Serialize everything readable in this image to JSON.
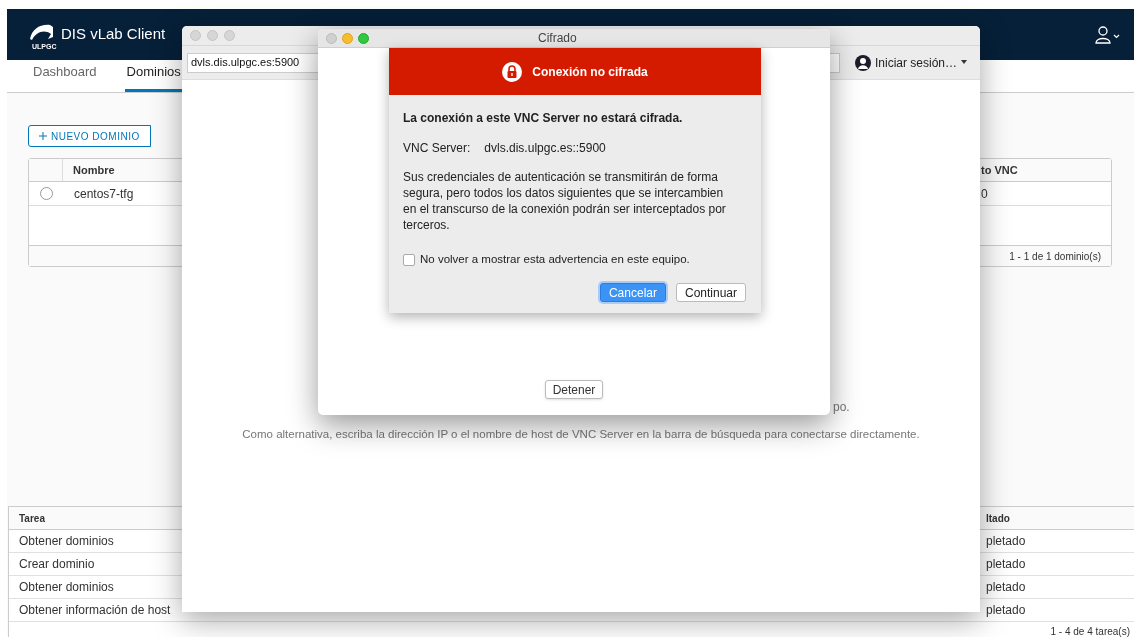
{
  "app": {
    "title": "DIS vLab Client",
    "logo_text": "ULPGC"
  },
  "tabs": [
    {
      "label": "Dashboard",
      "selected": false
    },
    {
      "label": "Dominios",
      "selected": true
    }
  ],
  "toolbar": {
    "new_button": "NUEVO DOMINIO"
  },
  "domains": {
    "columns": [
      "Nombre",
      "to VNC"
    ],
    "rows": [
      {
        "selected": false,
        "cells": [
          "centos7-tfg",
          "0"
        ]
      }
    ],
    "footer": "1 - 1 de 1 dominio(s)"
  },
  "tasks": {
    "columns": [
      "Tarea",
      "ltado"
    ],
    "rows": [
      {
        "cells": [
          "Obtener dominios",
          "pletado"
        ]
      },
      {
        "cells": [
          "Crear dominio",
          "pletado"
        ]
      },
      {
        "cells": [
          "Obtener dominios",
          "pletado"
        ]
      },
      {
        "cells": [
          "Obtener información de host",
          "pletado"
        ]
      }
    ],
    "footer": "1 - 4 de 4 tarea(s)"
  },
  "viewer": {
    "address": "dvls.dis.ulpgc.es:5900",
    "sign_in": "Iniciar sesión…",
    "hint_fragment": "po.",
    "hint": "Como alternativa, escriba la dirección IP o el nombre de host de VNC Server en la barra de búsqueda para conectarse directamente."
  },
  "dialog": {
    "title": "Cifrado",
    "banner": "Conexión no cifrada",
    "heading": "La conexión a este VNC Server no estará cifrada.",
    "server_label": "VNC Server:",
    "server_value": "dvls.dis.ulpgc.es::5900",
    "message": "Sus credenciales de autenticación se transmitirán de forma segura, pero todos los datos siguientes que se intercambien en el transcurso de la conexión podrán ser interceptados por terceros.",
    "checkbox": {
      "label": "No volver a mostrar esta advertencia en este equipo.",
      "checked": false
    },
    "buttons": [
      {
        "label": "Cancelar",
        "default": true
      },
      {
        "label": "Continuar",
        "default": false
      }
    ],
    "stop_button": "Detener"
  }
}
